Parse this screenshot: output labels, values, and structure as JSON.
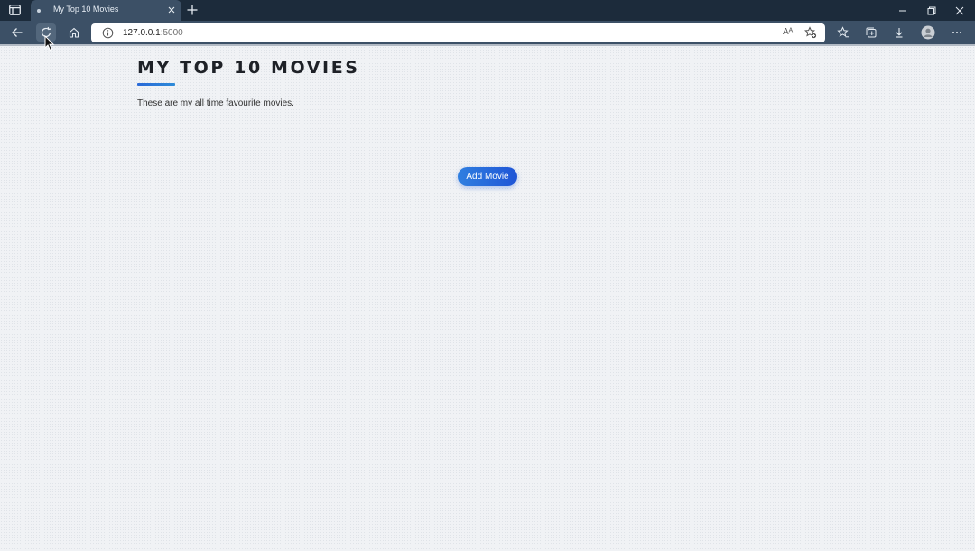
{
  "browser": {
    "tab": {
      "title": "My Top 10 Movies"
    },
    "address": {
      "host": "127.0.0.1",
      "port": ":5000"
    },
    "read_aloud_glyph": "Aᴬ"
  },
  "page": {
    "title": "MY TOP 10 MOVIES",
    "subtitle": "These are my all time favourite movies.",
    "add_button_label": "Add Movie"
  },
  "colors": {
    "titlebar": "#1c2b3b",
    "toolbar": "#3c5066",
    "accent": "#2a6ad8",
    "page_bg": "#f0f2f5"
  }
}
